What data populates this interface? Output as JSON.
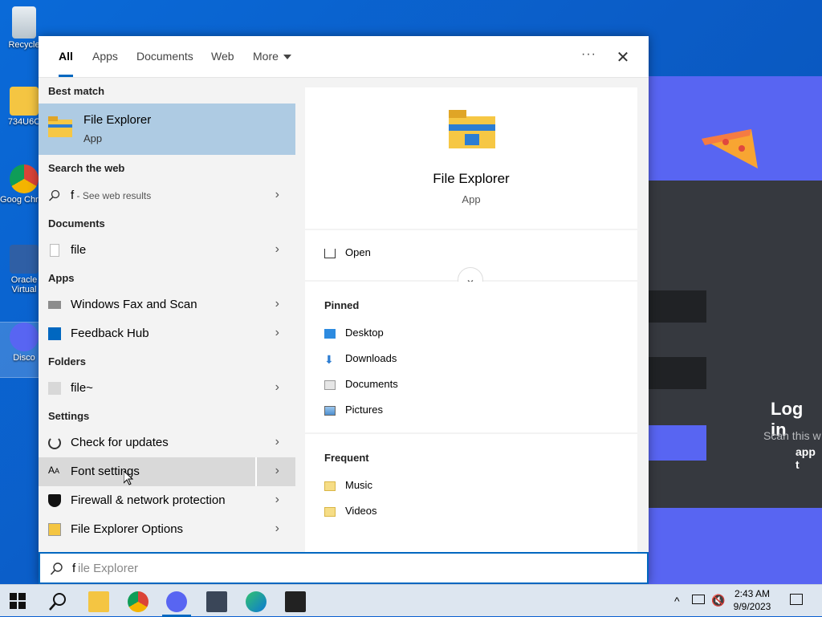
{
  "desktop": {
    "icons": [
      {
        "label": "Recycle"
      },
      {
        "label": "734U6C"
      },
      {
        "label": "Goog Chron"
      },
      {
        "label": "Oracle Virtual"
      },
      {
        "label": "Disco"
      }
    ]
  },
  "discord": {
    "login": "Log in",
    "scan": "Scan this w",
    "app": "app t"
  },
  "search": {
    "tabs": [
      "All",
      "Apps",
      "Documents",
      "Web",
      "More"
    ],
    "left": {
      "best_match_heading": "Best match",
      "best_match": {
        "title": "File Explorer",
        "sub": "App"
      },
      "web_heading": "Search the web",
      "web_query": "f",
      "web_suffix": " - See web results",
      "documents_heading": "Documents",
      "documents": [
        "file"
      ],
      "apps_heading": "Apps",
      "apps": [
        "Windows Fax and Scan",
        "Feedback Hub"
      ],
      "folders_heading": "Folders",
      "folders": [
        "file~"
      ],
      "settings_heading": "Settings",
      "settings": [
        "Check for updates",
        "Font settings",
        "Firewall & network protection",
        "File Explorer Options"
      ]
    },
    "right": {
      "title": "File Explorer",
      "sub": "App",
      "open": "Open",
      "pinned_heading": "Pinned",
      "pinned": [
        "Desktop",
        "Downloads",
        "Documents",
        "Pictures"
      ],
      "frequent_heading": "Frequent",
      "frequent": [
        "Music",
        "Videos"
      ]
    },
    "box": {
      "typed": "f",
      "ghost": "ile Explorer"
    }
  },
  "taskbar": {
    "time": "2:43 AM",
    "date": "9/9/2023"
  }
}
